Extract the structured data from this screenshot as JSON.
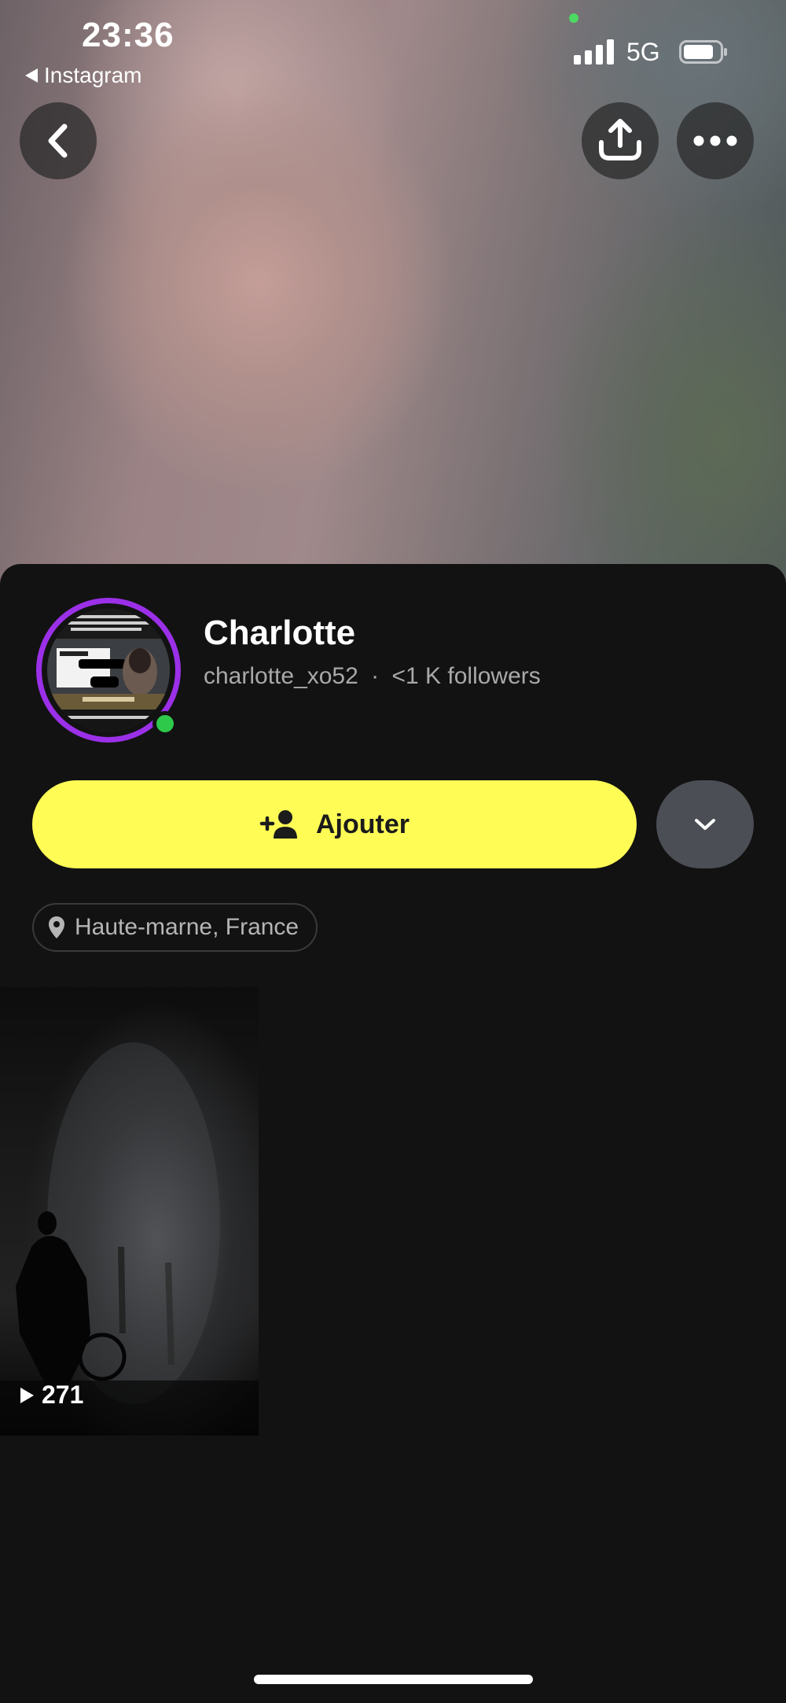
{
  "status_bar": {
    "time": "23:36",
    "back_app": "Instagram",
    "network": "5G"
  },
  "profile": {
    "display_name": "Charlotte",
    "username": "charlotte_xo52",
    "separator": "·",
    "followers": "<1 K followers",
    "online": true
  },
  "actions": {
    "add_label": "Ajouter"
  },
  "location": {
    "text": "Haute-marne, France"
  },
  "story": {
    "views": "271"
  },
  "colors": {
    "accent_yellow": "#fffc56",
    "avatar_ring": "#9b30e8",
    "online_green": "#2ec94b",
    "background": "#121212"
  },
  "icons": [
    "back-icon",
    "share-icon",
    "more-options-icon",
    "add-friend-icon",
    "chevron-down-icon",
    "location-pin-icon",
    "play-icon"
  ]
}
